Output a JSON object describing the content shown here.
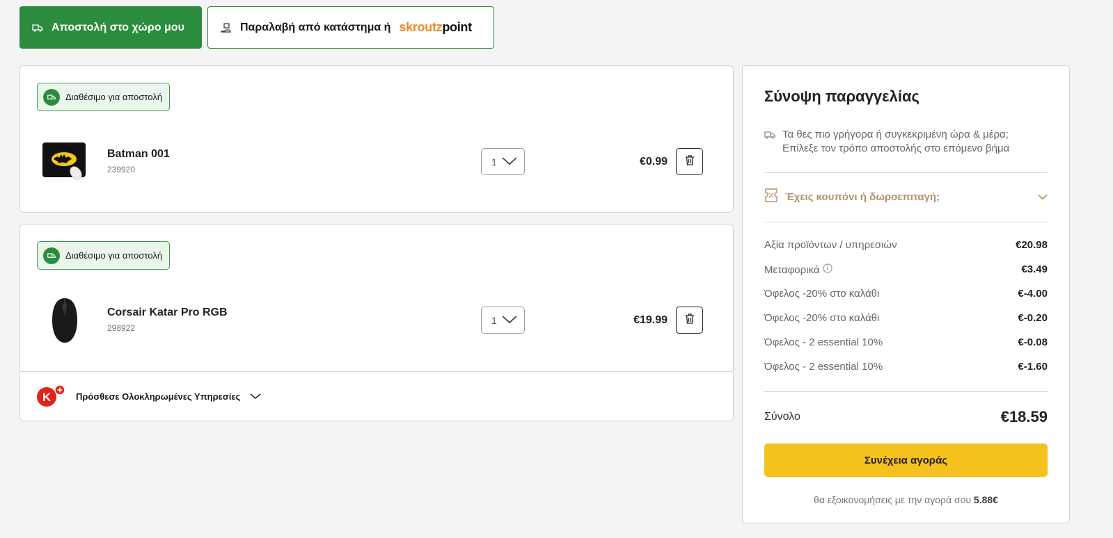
{
  "delivery_tabs": {
    "home_label": "Αποστολή στο χώρο μου",
    "pickup_label": "Παραλαβή από κατάστημα ή",
    "brand_part1": "skroutz",
    "brand_part2": "point"
  },
  "cart": {
    "items": [
      {
        "availability": "Διαθέσιμο για αποστολή",
        "name": "Batman 001",
        "sku": "239920",
        "qty": "1",
        "price": "€0.99"
      },
      {
        "availability": "Διαθέσιμο για αποστολή",
        "name": "Corsair Katar Pro RGB",
        "sku": "298922",
        "qty": "1",
        "price": "€19.99"
      }
    ],
    "services_label": "Πρόσθεσε Ολοκληρωμένες Υπηρεσίες",
    "services_logo_letter": "K"
  },
  "summary": {
    "title": "Σύνοψη παραγγελίας",
    "ship_note_line1": "Τα θες πιο γρήγορα ή συγκεκριμένη ώρα & μέρα;",
    "ship_note_line2": "Επίλεξε τον τρόπο αποστολής στο επόμενο βήμα",
    "coupon_label": "Έχεις κουπόνι ή δωροεπιταγή;",
    "rows": [
      {
        "label": "Αξία προϊόντων / υπηρεσιών",
        "value": "€20.98"
      },
      {
        "label": "Μεταφορικά",
        "value": "€3.49"
      },
      {
        "label": "Όφελος -20% στο καλάθι",
        "value": "€-4.00"
      },
      {
        "label": "Όφελος -20% στο καλάθι",
        "value": "€-0.20"
      },
      {
        "label": "Όφελος - 2 essential 10%",
        "value": "€-0.08"
      },
      {
        "label": "Όφελος - 2 essential 10%",
        "value": "€-1.60"
      }
    ],
    "total_label": "Σύνολο",
    "total_value": "€18.59",
    "cta_label": "Συνέχεια αγοράς",
    "savings_text": "θα εξοικονομήσεις με την αγορά σου",
    "savings_amount": "5.88€"
  },
  "colors": {
    "primary_green": "#2a8c3c",
    "cta_yellow": "#f5c11c",
    "coupon_tan": "#b0926a",
    "brand_orange": "#f08a24"
  }
}
